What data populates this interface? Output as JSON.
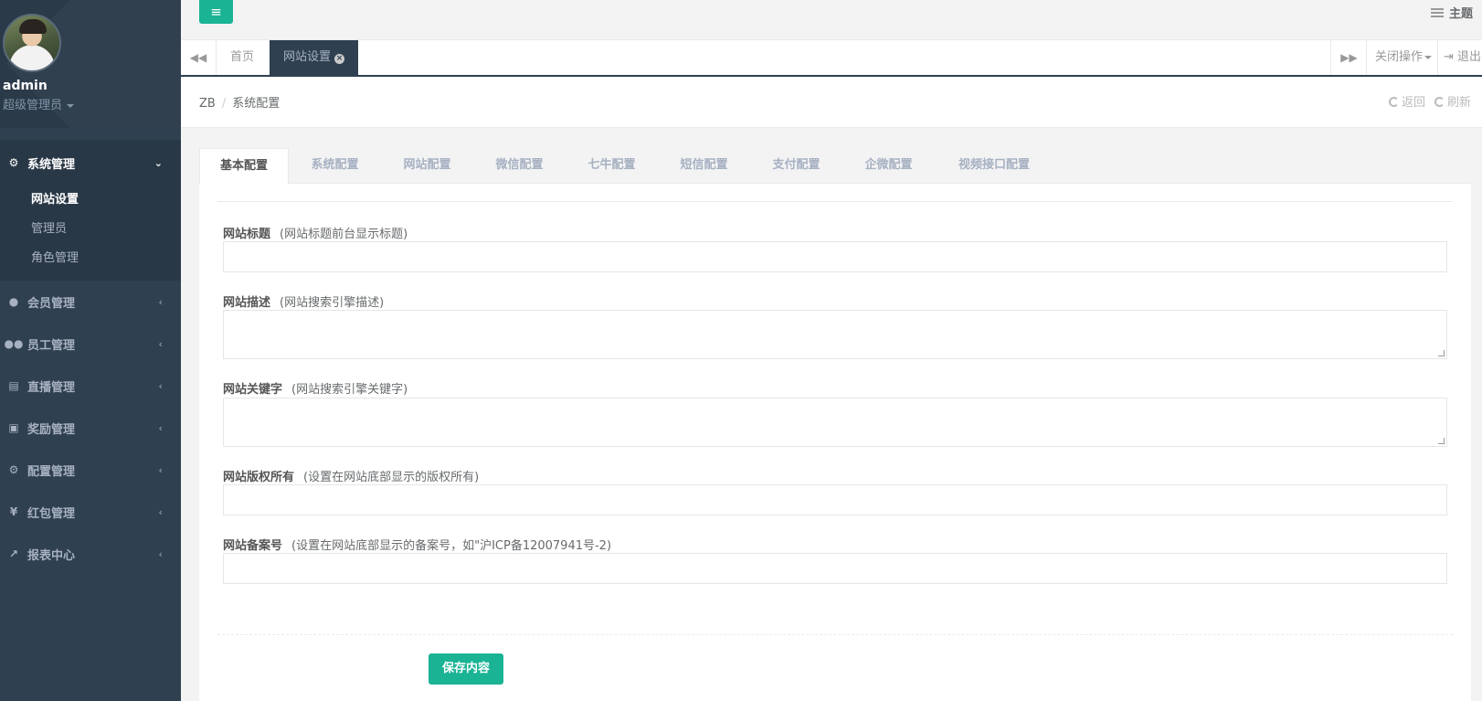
{
  "sidebar": {
    "profile": {
      "name": "admin",
      "role": "超级管理员"
    },
    "active_group": {
      "label": "系统管理",
      "items": [
        {
          "label": "网站设置",
          "current": true
        },
        {
          "label": "管理员",
          "current": false
        },
        {
          "label": "角色管理",
          "current": false
        }
      ]
    },
    "groups": [
      {
        "label": "会员管理",
        "icon": "user-icon"
      },
      {
        "label": "员工管理",
        "icon": "users-icon"
      },
      {
        "label": "直播管理",
        "icon": "file-icon"
      },
      {
        "label": "奖励管理",
        "icon": "gift-icon"
      },
      {
        "label": "配置管理",
        "icon": "gear-icon"
      },
      {
        "label": "红包管理",
        "icon": "yen-icon"
      },
      {
        "label": "报表中心",
        "icon": "chart-line-icon"
      }
    ]
  },
  "topbar": {
    "menu_icon": "bars-icon",
    "theme_label": "主题"
  },
  "tabstrip": {
    "tabs": [
      {
        "label": "首页"
      },
      {
        "label": "网站设置"
      }
    ],
    "close_ops_label": "关闭操作",
    "logout_label": "退出"
  },
  "breadcrumb": {
    "items": [
      "ZB",
      "系统配置"
    ],
    "back_label": "返回",
    "refresh_label": "刷新"
  },
  "config_tabs": [
    {
      "label": "基本配置",
      "active": true
    },
    {
      "label": "系统配置"
    },
    {
      "label": "网站配置"
    },
    {
      "label": "微信配置"
    },
    {
      "label": "七牛配置"
    },
    {
      "label": "短信配置"
    },
    {
      "label": "支付配置"
    },
    {
      "label": "企微配置"
    },
    {
      "label": "视频接口配置"
    }
  ],
  "form": {
    "fields": [
      {
        "label": "网站标题",
        "hint": "(网站标题前台显示标题)",
        "value": ""
      },
      {
        "label": "网站描述",
        "hint": "(网站搜索引擎描述)",
        "value": ""
      },
      {
        "label": "网站关键字",
        "hint": "(网站搜索引擎关键字)",
        "value": ""
      },
      {
        "label": "网站版权所有",
        "hint": "(设置在网站底部显示的版权所有)",
        "value": ""
      },
      {
        "label": "网站备案号",
        "hint": "(设置在网站底部显示的备案号，如\"沪ICP备12007941号-2)",
        "value": ""
      }
    ],
    "save_label": "保存内容"
  },
  "colors": {
    "sidebar_bg": "#2f4050",
    "accent": "#1ab394"
  }
}
